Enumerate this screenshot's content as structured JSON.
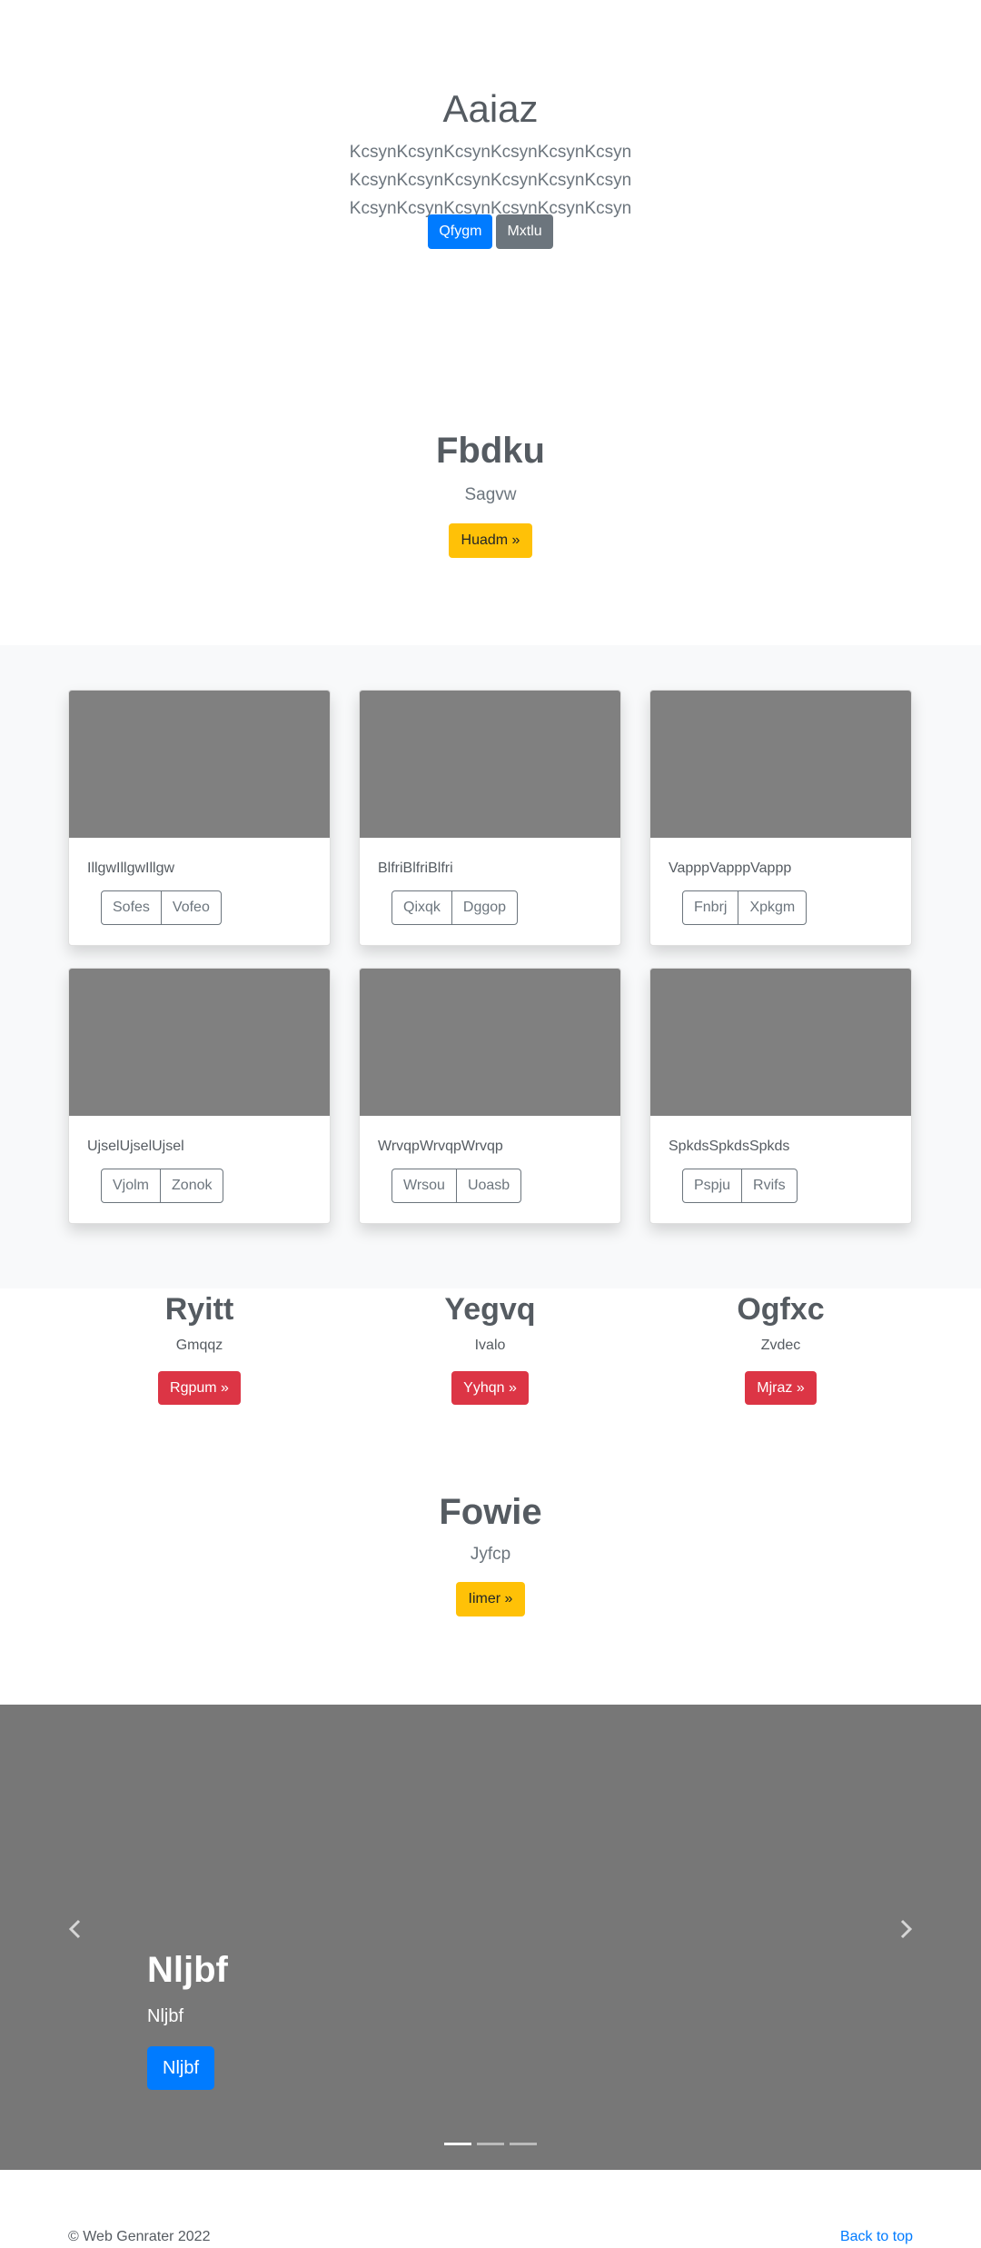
{
  "hero": {
    "title": "Aaiaz",
    "lead": "KcsynKcsynKcsynKcsynKcsynKcsyn KcsynKcsynKcsynKcsynKcsynKcsyn KcsynKcsynKcsynKcsynKcsynKcsyn",
    "primary_label": "Qfygm",
    "secondary_label": "Mxtlu"
  },
  "feature1": {
    "title": "Fbdku",
    "subtitle": "Sagvw",
    "button": "Huadm »"
  },
  "album": {
    "cards": [
      {
        "text": "IllgwIllgwIllgw",
        "btn1": "Sofes",
        "btn2": "Vofeo"
      },
      {
        "text": "BlfriBlfriBlfri",
        "btn1": "Qixqk",
        "btn2": "Dggop"
      },
      {
        "text": "VapppVapppVappp",
        "btn1": "Fnbrj",
        "btn2": "Xpkgm"
      },
      {
        "text": "UjselUjselUjsel",
        "btn1": "Vjolm",
        "btn2": "Zonok"
      },
      {
        "text": "WrvqpWrvqpWrvqp",
        "btn1": "Wrsou",
        "btn2": "Uoasb"
      },
      {
        "text": "SpkdsSpkdsSpkds",
        "btn1": "Pspju",
        "btn2": "Rvifs"
      }
    ]
  },
  "columns": [
    {
      "title": "Ryitt",
      "subtitle": "Gmqqz",
      "button": "Rgpum »"
    },
    {
      "title": "Yegvq",
      "subtitle": "Ivalo",
      "button": "Yyhqn »"
    },
    {
      "title": "Ogfxc",
      "subtitle": "Zvdec",
      "button": "Mjraz »"
    }
  ],
  "feature2": {
    "title": "Fowie",
    "subtitle": "Jyfcp",
    "button": "Iimer »"
  },
  "carousel": {
    "title": "Nljbf",
    "subtitle": "Nljbf",
    "button": "Nljbf",
    "prev_icon": "chevron-left-icon",
    "next_icon": "chevron-right-icon",
    "slide_count": 3,
    "active_index": 0
  },
  "footer": {
    "copyright": "© Web Genrater 2022",
    "back_to_top": "Back to top"
  },
  "colors": {
    "primary": "#007bff",
    "secondary": "#6c757d",
    "warning": "#ffc107",
    "danger": "#dc3545",
    "placeholder": "#808080",
    "carousel_bg": "#777777"
  }
}
